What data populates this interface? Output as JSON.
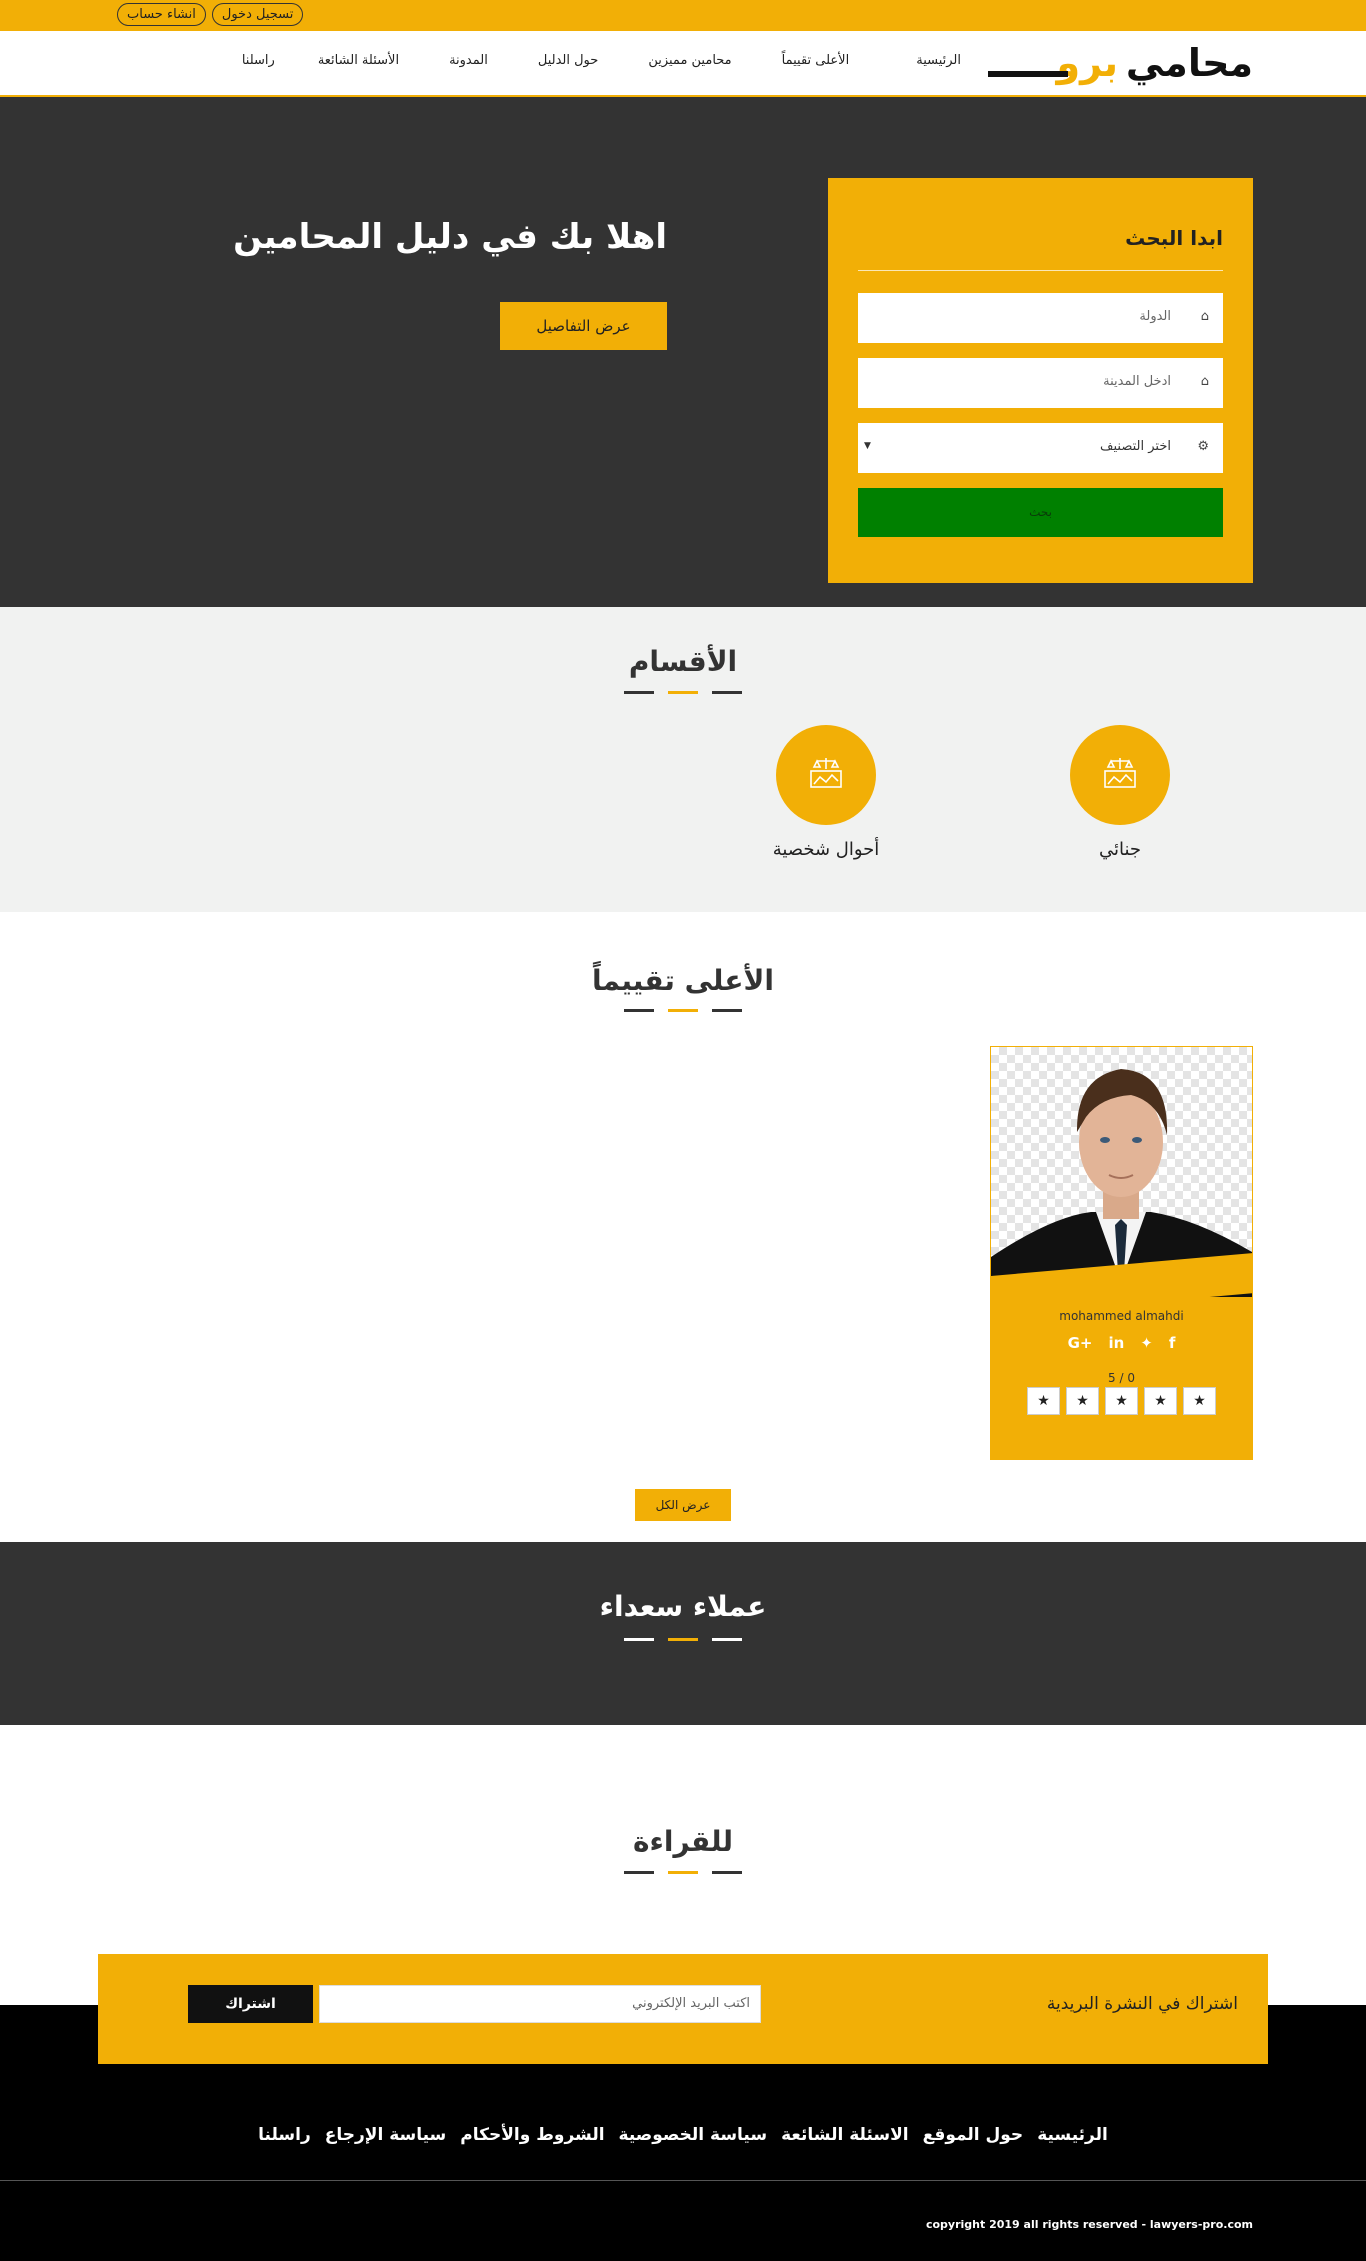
{
  "topbar": {
    "login": "تسجيل دخول",
    "register": "انشاء حساب"
  },
  "logo": {
    "part1": "محامي",
    "part2": "برو"
  },
  "nav": [
    "الرئيسية",
    "الأعلى تقييماً",
    "محامين مميزين",
    "حول الدليل",
    "المدونة",
    "الأسئلة الشائعة",
    "راسلنا"
  ],
  "hero": {
    "title": "اهلا بك في دليل المحامين",
    "details_button": "عرض التفاصيل",
    "search": {
      "title": "ابدا البحث",
      "country_placeholder": "الدولة",
      "city_placeholder": "ادخل المدينة",
      "category_placeholder": "اختر التصنيف",
      "submit": "بحث"
    }
  },
  "categories": {
    "title": "الأقسام",
    "items": [
      "جنائي",
      "أحوال شخصية"
    ]
  },
  "top_rated": {
    "title": "الأعلى تقييماً",
    "lawyer": {
      "name": "mohammed almahdi",
      "score": "5 / 0",
      "stars": 5
    },
    "socials": [
      "G+",
      "in",
      "t",
      "f"
    ],
    "view_all": "عرض الكل"
  },
  "clients": {
    "title": "عملاء سعداء"
  },
  "reading": {
    "title": "للقراءة"
  },
  "newsletter": {
    "title": "اشتراك في النشرة البريدية",
    "email_placeholder": "اكتب البريد الإلكتروني",
    "subscribe": "اشتراك"
  },
  "footer": {
    "links": [
      "الرئيسية",
      "حول الموقع",
      "الاسئلة الشائعة",
      "سياسة الخصوصية",
      "الشروط والأحكام",
      "سياسة الإرجاع",
      "راسلنا"
    ],
    "copyright": "copyright 2019 all rights reserved - lawyers-pro.com"
  },
  "colors": {
    "brand": "#f2af06",
    "dark": "#333333",
    "search_button": "#008000"
  }
}
